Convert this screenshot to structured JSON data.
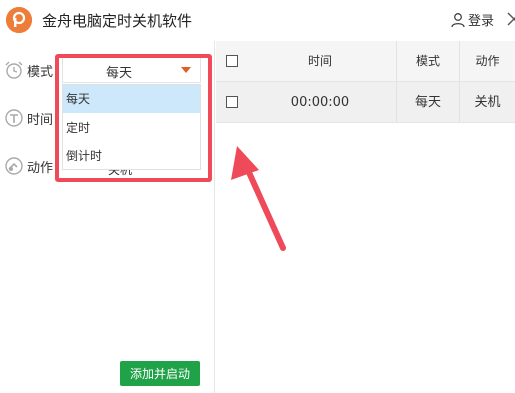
{
  "app": {
    "title": "金舟电脑定时关机软件"
  },
  "header": {
    "login_label": "登录"
  },
  "form": {
    "mode_label": "模式",
    "time_label": "时间",
    "action_label": "动作",
    "mode_select": {
      "selected": "每天",
      "options": [
        "每天",
        "定时",
        "倒计时"
      ],
      "highlighted_index": 0
    },
    "action_value_partial": "关机",
    "submit_label": "添加并启动"
  },
  "table": {
    "columns": [
      "时间",
      "模式",
      "动作"
    ],
    "rows": [
      {
        "time": "00:00:00",
        "mode": "每天",
        "action": "关机"
      }
    ]
  },
  "colors": {
    "accent": "#ef7d3a",
    "button_green": "#20a248",
    "highlight_red": "#ee4a5a",
    "option_selected": "#cde8fb"
  },
  "icons": [
    "app-logo-icon",
    "user-icon",
    "alarm-clock-icon",
    "time-icon",
    "action-icon",
    "dropdown-arrow-icon"
  ]
}
